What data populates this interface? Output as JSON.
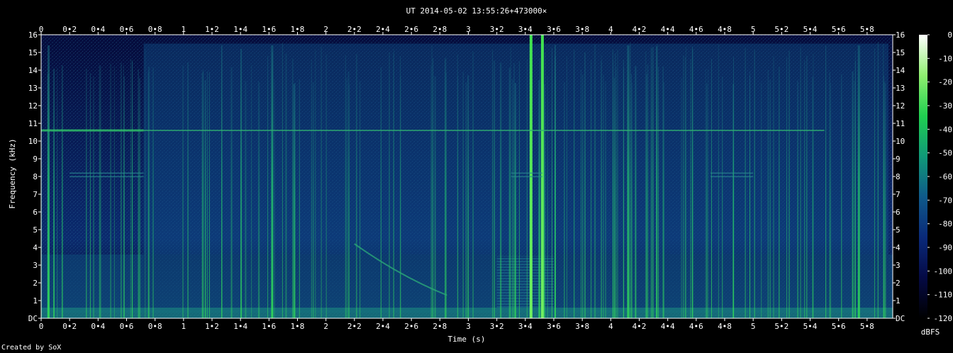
{
  "chart_data": {
    "type": "heatmap",
    "title": "UT 2014-05-02 13:55:26+473000×",
    "xlabel": "Time (s)",
    "ylabel": "Frequency (kHz)",
    "xlim": [
      0,
      5.98
    ],
    "ylim": [
      0,
      16
    ],
    "x_ticks": [
      "0",
      "0•2",
      "0•4",
      "0•6",
      "0•8",
      "1",
      "1•2",
      "1•4",
      "1•6",
      "1•8",
      "2",
      "2•2",
      "2•4",
      "2•6",
      "2•8",
      "3",
      "3•2",
      "3•4",
      "3•6",
      "3•8",
      "4",
      "4•2",
      "4•4",
      "4•6",
      "4•8",
      "5",
      "5•2",
      "5•4",
      "5•6",
      "5•8"
    ],
    "y_ticks": [
      "DC",
      "1",
      "2",
      "3",
      "4",
      "5",
      "6",
      "7",
      "8",
      "9",
      "10",
      "11",
      "12",
      "13",
      "14",
      "15",
      "16"
    ],
    "colorbar": {
      "unit": "dBFS",
      "range": [
        -120,
        0
      ],
      "ticks": [
        "0",
        "-10",
        "-20",
        "-30",
        "-40",
        "-50",
        "-60",
        "-70",
        "-80",
        "-90",
        "-100",
        "-110",
        "-120"
      ],
      "colors": [
        "#000000",
        "#050a45",
        "#0a2a7a",
        "#0f5a8a",
        "#109a78",
        "#20d050",
        "#90f070",
        "#ffffff"
      ]
    },
    "features": {
      "strong_lines_s": [
        3.44,
        3.52
      ],
      "bright_lines_s": [
        0.05,
        1.62,
        4.12,
        5.74
      ],
      "tone_khz": 10.6,
      "tone_gap_s": [
        0.72,
        5.5
      ],
      "low_band_khz": [
        0.3,
        3.6
      ],
      "activity_s": [
        0.72,
        5.95
      ],
      "sweep": {
        "t": [
          2.2,
          2.85
        ],
        "f_khz": [
          4.2,
          1.3
        ]
      },
      "hatch": {
        "t": [
          3.2,
          3.6
        ],
        "f_khz": [
          0.5,
          3.5
        ]
      },
      "aux_tone_khz": [
        8.2,
        8.0
      ],
      "aux_tone_s": [
        [
          0.2,
          0.72
        ],
        [
          3.3,
          3.52
        ],
        [
          4.7,
          5.0
        ]
      ]
    }
  },
  "footer": {
    "credit": "Created by SoX"
  }
}
